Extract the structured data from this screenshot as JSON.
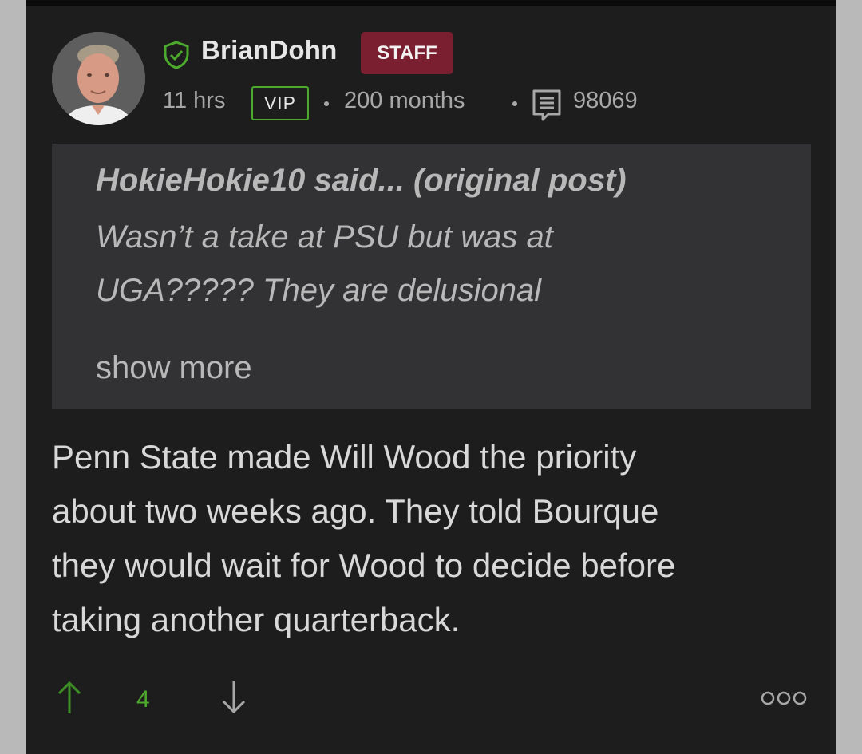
{
  "post": {
    "username": "BrianDohn",
    "role_badge": "STAFF",
    "time": "11 hrs",
    "vip_label": "VIP",
    "tenure": "200 months",
    "post_count": "98069"
  },
  "quote": {
    "author": "HokieHokie10 said... (original post)",
    "lines": [
      "Wasn’t a take at PSU but was at",
      "UGA????? They are delusional"
    ],
    "show_more": "show more"
  },
  "body": {
    "lines": [
      "Penn State made Will Wood the priority",
      "about two weeks ago. They told Bourque",
      "they would wait for Wood to decide before",
      "taking another quarterback."
    ]
  },
  "footer": {
    "vote_count": "4"
  },
  "icons": {
    "verified": "shield-check-icon",
    "posts": "message-icon",
    "upvote": "arrow-up-icon",
    "downvote": "arrow-down-icon",
    "more": "more-options-icon"
  },
  "colors": {
    "background": "#1d1d1d",
    "quote_background": "#323234",
    "staff_badge": "#7a1f2f",
    "accent_green": "#4caa2c"
  }
}
